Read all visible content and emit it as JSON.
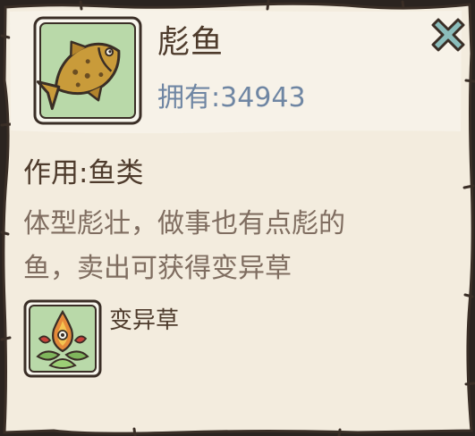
{
  "item": {
    "name": "彪鱼",
    "owned_text": "拥有:34943",
    "icon": "fish-icon"
  },
  "effect": {
    "label": "作用:鱼类"
  },
  "description": {
    "line1": "体型彪壮，做事也有点彪的",
    "line2": "鱼，卖出可获得变异草"
  },
  "reward": {
    "name": "变异草",
    "icon": "mutant-grass-icon"
  },
  "close": {
    "icon": "close-icon"
  },
  "colors": {
    "panel_bg": "#f3ecde",
    "header_bg": "#f6f1e6",
    "title_text": "#4e3b2c",
    "owned_text": "#6f86a3",
    "desc_text": "#7f6d60",
    "icon_bg": "#b9d9a9",
    "close_fill": "#8bbdbb"
  }
}
